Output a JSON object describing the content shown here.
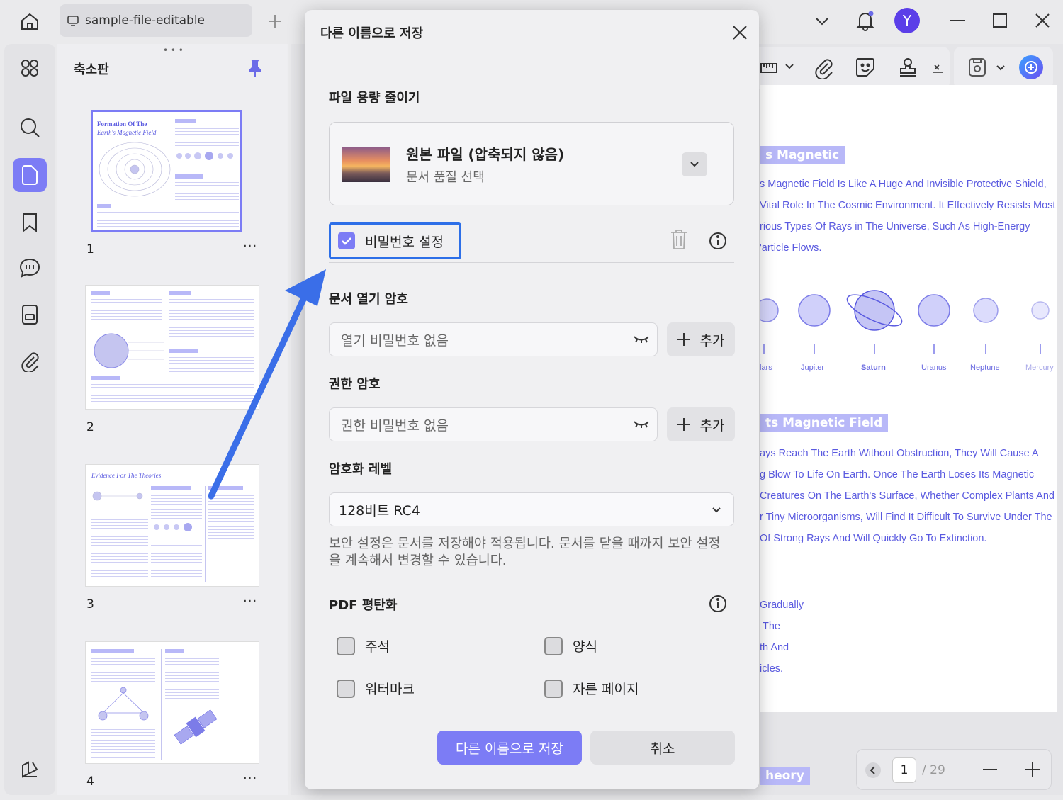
{
  "tab": {
    "title": "sample-file-editable"
  },
  "user": {
    "avatar_letter": "Y"
  },
  "colors": {
    "accent": "#7c7cf5",
    "arrow": "#3a6ee8",
    "doc_text": "#5a5ae0"
  },
  "thumbnail_panel": {
    "title": "축소판",
    "pages": [
      {
        "number": "1",
        "heading": "Formation Of The",
        "heading2": "Earth's Magnetic Field"
      },
      {
        "number": "2"
      },
      {
        "number": "3",
        "heading": "Evidence For The Theories"
      },
      {
        "number": "4"
      }
    ],
    "more_label": "···"
  },
  "dialog": {
    "title": "다른 이름으로 저장",
    "reduce_size": {
      "heading": "파일 용량 줄이기",
      "option_title": "원본 파일 (압축되지 않음)",
      "option_sub": "문서 품질 선택"
    },
    "password": {
      "checkbox_label": "비밀번호 설정",
      "checked": true,
      "open_heading": "문서 열기 암호",
      "open_placeholder": "열기 비밀번호 없음",
      "perm_heading": "권한 암호",
      "perm_placeholder": "권한 비밀번호 없음",
      "add_label": "추가",
      "encryption_heading": "암호화 레벨",
      "encryption_value": "128비트 RC4",
      "note": "보안 설정은 문서를 저장해야 적용됩니다. 문서를 닫을 때까지 보안 설정을 계속해서 변경할 수 있습니다."
    },
    "flatten": {
      "heading": "PDF 평탄화",
      "options": [
        "주석",
        "양식",
        "워터마크",
        "자른 페이지"
      ]
    },
    "save_button": "다른 이름으로 저장",
    "cancel_button": "취소"
  },
  "document": {
    "heading1": "s Magnetic",
    "lines1": [
      "s Magnetic Field Is Like A Huge And Invisible Protective Shield,",
      "Vital Role In The Cosmic Environment. It Effectively Resists Most",
      "rious Types Of Rays in The Universe, Such As High-Energy",
      "'article Flows."
    ],
    "planets": [
      "lars",
      "Jupiter",
      "Saturn",
      "Uranus",
      "Neptune",
      "Mercury"
    ],
    "heading2": "ts Magnetic Field",
    "lines2": [
      "ays Reach The Earth Without Obstruction, They Will Cause A",
      "g Blow To Life On Earth. Once The Earth Loses Its Magnetic",
      "Creatures On The Earth's Surface, Whether Complex Plants And",
      "r Tiny Microorganisms, Will Find It Difficult To Survive Under The",
      "Of Strong Rays And Will Quickly Go To Extinction."
    ],
    "lines3": [
      "Gradually",
      "The",
      "th And",
      "icles."
    ],
    "heading3": "heory"
  },
  "page_nav": {
    "current": "1",
    "total": "/ 29"
  }
}
